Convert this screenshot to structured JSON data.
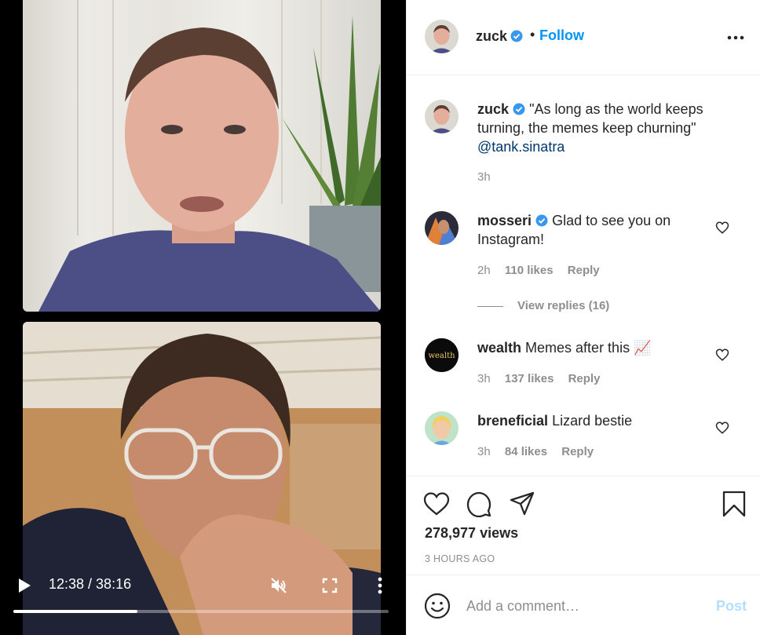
{
  "video": {
    "current_time": "12:38",
    "duration": "38:16",
    "time_display": "12:38 / 38:16",
    "progress_fraction": 0.33
  },
  "post": {
    "author": "zuck",
    "follow_label": "Follow",
    "separator": "•",
    "caption": "\"As long as the world keeps turning, the memes keep churning\"",
    "caption_mention": "@tank.sinatra",
    "caption_time": "3h",
    "views": "278,977 views",
    "posted_ago": "3 HOURS AGO"
  },
  "comments": [
    {
      "user": "mosseri",
      "verified": true,
      "text": "Glad to see you on Instagram!",
      "time": "2h",
      "likes": "110 likes",
      "reply_label": "Reply",
      "view_replies": "View replies (16)"
    },
    {
      "user": "wealth",
      "verified": false,
      "text": "Memes after this 📈",
      "time": "3h",
      "likes": "137 likes",
      "reply_label": "Reply",
      "avatar_text": "wealth"
    },
    {
      "user": "breneficial",
      "verified": false,
      "text": "Lizard bestie",
      "time": "3h",
      "likes": "84 likes",
      "reply_label": "Reply"
    }
  ],
  "comment_box": {
    "placeholder": "Add a comment…",
    "post_label": "Post"
  },
  "colors": {
    "accent": "#0095f6",
    "verified": "#3897f0",
    "muted": "#8e8e8e",
    "text": "#262626",
    "post_disabled": "#b2dffc"
  },
  "icons": {
    "play": "play-icon",
    "mute": "muted-speaker-icon",
    "fullscreen": "fullscreen-icon",
    "more": "more-icon",
    "like": "heart-icon",
    "comment": "comment-bubble-icon",
    "share": "paper-plane-icon",
    "save": "bookmark-icon",
    "emoji": "emoji-icon"
  }
}
